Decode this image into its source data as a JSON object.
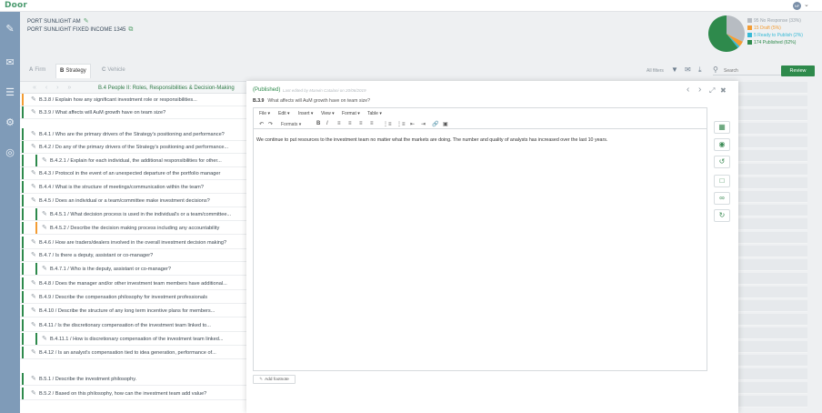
{
  "app": {
    "logo": "Door",
    "avatar_initials": "NF"
  },
  "rail": {
    "items": [
      {
        "name": "rail-documents-icon",
        "glyph": "✎"
      },
      {
        "name": "rail-chat-icon",
        "glyph": "✉"
      },
      {
        "name": "rail-reports-icon",
        "glyph": "☰"
      },
      {
        "name": "rail-settings-icon",
        "glyph": "⚙"
      },
      {
        "name": "rail-support-icon",
        "glyph": "◎"
      }
    ]
  },
  "fund": {
    "line1": "PORT SUNLIGHT AM",
    "line2": "PORT SUNLIGHT FIXED INCOME 1345"
  },
  "status_chart": {
    "type": "pie",
    "slices": [
      {
        "label": "95 No Response (33%)",
        "value": 33,
        "color": "#b7bcc2"
      },
      {
        "label": "15 Draft (5%)",
        "value": 5,
        "color": "#f39c33"
      },
      {
        "label": "5 Ready to Publish (2%)",
        "value": 2,
        "color": "#35b9d6"
      },
      {
        "label": "174 Published (62%)",
        "value": 62,
        "color": "#2e8a4c"
      }
    ]
  },
  "tabs": [
    {
      "letter": "A",
      "label": "Firm",
      "active": false
    },
    {
      "letter": "B",
      "label": "Strategy",
      "active": true
    },
    {
      "letter": "C",
      "label": "Vehicle",
      "active": false
    }
  ],
  "toolbar": {
    "filters_label": "All filters",
    "search_placeholder": "Search",
    "review_label": "Review"
  },
  "section": {
    "ghost": "« ‹ › »",
    "title": "B.4 People II: Roles, Responsibilities & Decision-Making"
  },
  "questions": [
    {
      "text": "B.3.8 / Explain how any significant investment role or responsibilities...",
      "status": "draft",
      "level": 1
    },
    {
      "text": "B.3.9 / What affects will AuM growth have on team size?",
      "status": "published",
      "level": 1
    },
    {
      "text": "B.4.1 / Who are the primary drivers of the Strategy's positioning and performance?",
      "status": "published",
      "level": 1
    },
    {
      "text": "B.4.2 / Do any of the primary drivers of the Strategy's positioning and performance...",
      "status": "published",
      "level": 1
    },
    {
      "text": "B.4.2.1 / Explain for each individual, the additional responsibilities for other...",
      "status": "published",
      "level": 2
    },
    {
      "text": "B.4.3 / Protocol in the event of an unexpected departure of the portfolio manager",
      "status": "published",
      "level": 1
    },
    {
      "text": "B.4.4 / What is the structure of meetings/communication within the team?",
      "status": "published",
      "level": 1
    },
    {
      "text": "B.4.5 / Does an individual or a team/committee make investment decisions?",
      "status": "published",
      "level": 1
    },
    {
      "text": "B.4.5.1 / What decision process is used in the individual's or a team/committee...",
      "status": "published",
      "level": 2
    },
    {
      "text": "B.4.5.2 / Describe the decision making process including any accountability",
      "status": "draft",
      "level": 2
    },
    {
      "text": "B.4.6 / How are traders/dealers involved in the overall investment decision making?",
      "status": "published",
      "level": 1
    },
    {
      "text": "B.4.7 / Is there a deputy, assistant or co-manager?",
      "status": "published",
      "level": 1
    },
    {
      "text": "B.4.7.1 / Who is the deputy, assistant or co-manager?",
      "status": "published",
      "level": 2
    },
    {
      "text": "B.4.8 / Does the manager and/or other investment team members have additional...",
      "status": "published",
      "level": 1
    },
    {
      "text": "B.4.9 / Describe the compensation philosophy for investment professionals",
      "status": "published",
      "level": 1
    },
    {
      "text": "B.4.10 / Describe the structure of any long term incentive plans for members...",
      "status": "published",
      "level": 1
    },
    {
      "text": "B.4.11 / Is the discretionary compensation of the investment team linked to...",
      "status": "published",
      "level": 1
    },
    {
      "text": "B.4.11.1 / How is discretionary compensation of the investment team linked...",
      "status": "published",
      "level": 2
    },
    {
      "text": "B.4.12 / Is an analyst's compensation tied to idea generation, performance of...",
      "status": "published",
      "level": 1
    },
    {
      "text": "B.5.1 / Describe the investment philosophy.",
      "status": "published",
      "level": 1
    },
    {
      "text": "B.5.2 / Based on this philosophy, how can the investment team add value?",
      "status": "published",
      "level": 1
    }
  ],
  "status_colors": {
    "published": "#2e8a4c",
    "draft": "#f39c33",
    "none": "#b7bcc2"
  },
  "editor": {
    "status": "(Published)",
    "meta": "Last edited by Marwin Catalani on 20/06/2019",
    "question_code": "B.3.9",
    "question_text": "What affects will AuM growth have on team size?",
    "menu": [
      "File ▾",
      "Edit ▾",
      "Insert ▾",
      "View ▾",
      "Format ▾",
      "Table ▾"
    ],
    "formats_label": "Formats ▾",
    "content": "We continue to put resources to the investment team no matter what the markets are doing. The number and quality of analysts has increased over the last 10 years.",
    "add_footnote": "Add footnote"
  }
}
